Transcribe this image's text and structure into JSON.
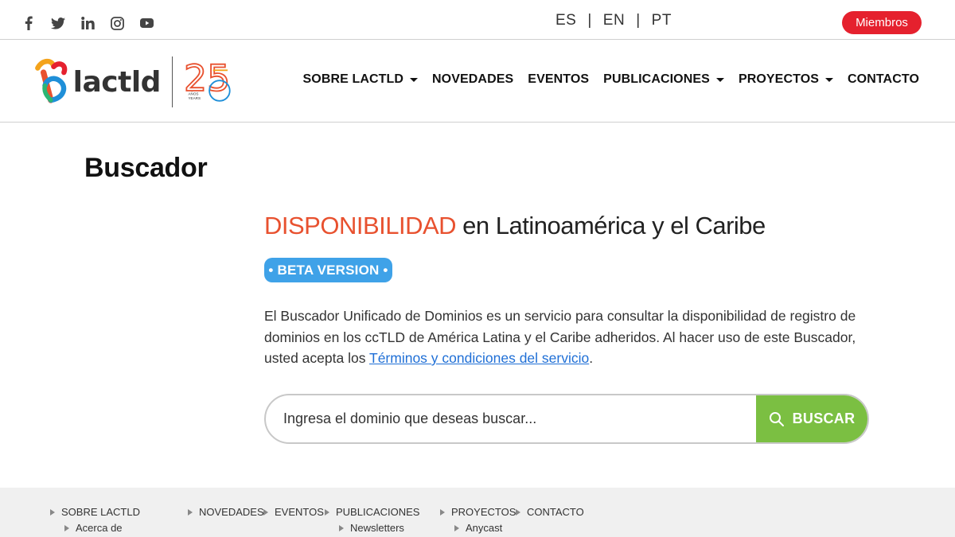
{
  "topbar": {
    "social": [
      "facebook-icon",
      "twitter-icon",
      "linkedin-icon",
      "instagram-icon",
      "youtube-icon"
    ],
    "languages": [
      "ES",
      "EN",
      "PT"
    ],
    "separator": "|",
    "members_label": "Miembros"
  },
  "header": {
    "logo_text": "lactld",
    "anniversary": "25",
    "anniversary_caption_1": "AÑOS",
    "anniversary_caption_2": "YEARS",
    "nav": [
      {
        "label": "SOBRE LACTLD",
        "dropdown": true
      },
      {
        "label": "NOVEDADES",
        "dropdown": false
      },
      {
        "label": "EVENTOS",
        "dropdown": false
      },
      {
        "label": "PUBLICACIONES",
        "dropdown": true
      },
      {
        "label": "PROYECTOS",
        "dropdown": true
      },
      {
        "label": "CONTACTO",
        "dropdown": false
      }
    ]
  },
  "main": {
    "page_title": "Buscador",
    "heading_accent": "DISPONIBILIDAD",
    "heading_rest": " en Latinoamérica y el Caribe",
    "beta_badge": "• BETA VERSION •",
    "description": "El Buscador Unificado de Dominios es un servicio para consultar la disponibilidad de registro de dominios en los ccTLD de América Latina y el Caribe adheridos. Al hacer uso de este Buscador, usted acepta los ",
    "terms_link": "Términos y condiciones del servicio",
    "description_end": ".",
    "search": {
      "placeholder": "Ingresa el dominio que deseas buscar...",
      "value": "",
      "button_label": "BUSCAR"
    }
  },
  "footer": {
    "columns": [
      {
        "label": "SOBRE LACTLD",
        "sub": "Acerca de"
      },
      {
        "label": "NOVEDADES",
        "sub": ""
      },
      {
        "label": "EVENTOS",
        "sub": ""
      },
      {
        "label": "PUBLICACIONES",
        "sub": "Newsletters"
      },
      {
        "label": "PROYECTOS",
        "sub": "Anycast"
      },
      {
        "label": "CONTACTO",
        "sub": ""
      }
    ]
  },
  "colors": {
    "accent_red": "#e5212e",
    "heading_orange": "#e8512f",
    "beta_blue": "#3fa2e8",
    "search_green": "#7bbf42",
    "link_blue": "#1f6fd6"
  }
}
